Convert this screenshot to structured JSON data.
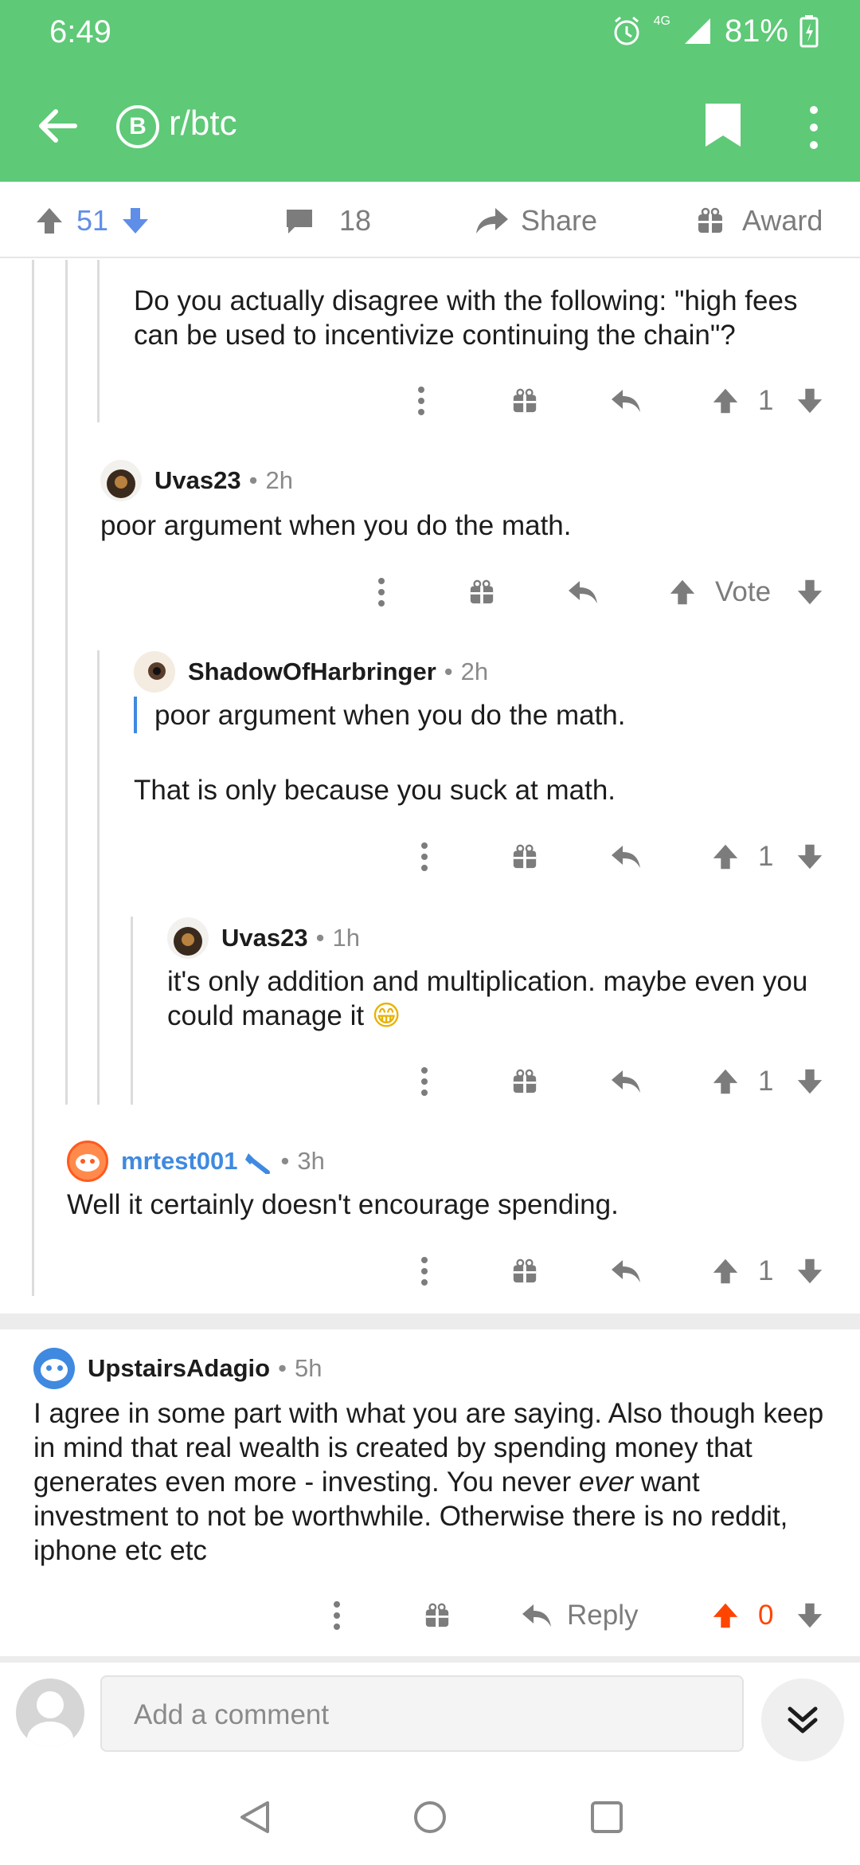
{
  "status_bar": {
    "time": "6:49",
    "network": "4G",
    "battery": "81%"
  },
  "app_bar": {
    "subreddit": "r/btc",
    "subreddit_icon": "B"
  },
  "post_actions": {
    "score": "51",
    "comments": "18",
    "share": "Share",
    "award": "Award"
  },
  "comments": [
    {
      "text": "Do you actually disagree with the following: \"high fees can be used to incentivize continuing the chain\"?",
      "score": "1"
    },
    {
      "author": "Uvas23",
      "age": "2h",
      "text": "poor argument when you do the math.",
      "score": "Vote"
    },
    {
      "author": "ShadowOfHarbringer",
      "age": "2h",
      "quote": "poor argument when you do the math.",
      "text": "That is only because you suck at math.",
      "score": "1"
    },
    {
      "author": "Uvas23",
      "age": "1h",
      "text": "it's only addition and multiplication. maybe even you could manage it",
      "emoji": "😁",
      "score": "1"
    },
    {
      "author": "mrtest001",
      "age": "3h",
      "text": "Well it certainly doesn't encourage spending.",
      "score": "1"
    },
    {
      "author": "UpstairsAdagio",
      "age": "5h",
      "text_before": "I agree in some part with what you are saying. Also though keep in mind that real wealth is created by spending money that generates even more - investing. You never ",
      "text_em": "ever",
      "text_after": " want investment to not be worthwhile. Otherwise there is no reddit, iphone etc etc",
      "reply": "Reply",
      "score": "0"
    }
  ],
  "composer": {
    "placeholder": "Add a comment"
  },
  "colors": {
    "header": "#5ec977",
    "upvote_blue": "#5f8ee8",
    "mod_blue": "#3f8ae0",
    "upvoted_orange": "#ff4500"
  }
}
